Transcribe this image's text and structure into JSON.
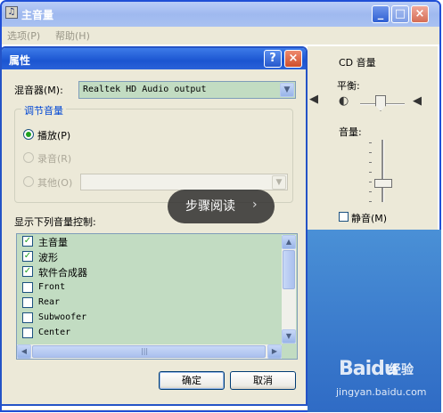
{
  "main_window": {
    "title": "主音量",
    "menu": [
      "选项(P)",
      "帮助(H)"
    ],
    "cd_panel": {
      "title": "CD 音量",
      "balance_label": "平衡:",
      "volume_label": "音量:",
      "mute_label": "静音(M)"
    }
  },
  "dialog": {
    "title": "属性",
    "help": "?",
    "close": "×",
    "mixer_label": "混音器(M):",
    "mixer_value": "Realtek HD Audio output",
    "group_title": "调节音量",
    "radios": [
      {
        "label": "播放(P)",
        "selected": true,
        "enabled": true
      },
      {
        "label": "录音(R)",
        "selected": false,
        "enabled": false
      },
      {
        "label": "其他(O)",
        "selected": false,
        "enabled": false
      }
    ],
    "list_label": "显示下列音量控制:",
    "list_items": [
      {
        "label": "主音量",
        "checked": true
      },
      {
        "label": "波形",
        "checked": true
      },
      {
        "label": "软件合成器",
        "checked": true
      },
      {
        "label": "Front",
        "checked": false
      },
      {
        "label": "Rear",
        "checked": false
      },
      {
        "label": "Subwoofer",
        "checked": false
      },
      {
        "label": "Center",
        "checked": false
      }
    ],
    "ok_label": "确定",
    "cancel_label": "取消"
  },
  "overlay": {
    "label": "步骤阅读",
    "arrow": "›"
  },
  "watermark": {
    "logo": "Baidu",
    "brand": "经验",
    "url": "jingyan.baidu.com"
  },
  "icons": {
    "speaker": "speaker-icon",
    "dropdown": "chevron-down-icon",
    "check": "checkmark-icon"
  },
  "colors": {
    "title_bar": "#1b55d1",
    "list_bg": "#c2dcc2",
    "accent": "#21a121"
  }
}
